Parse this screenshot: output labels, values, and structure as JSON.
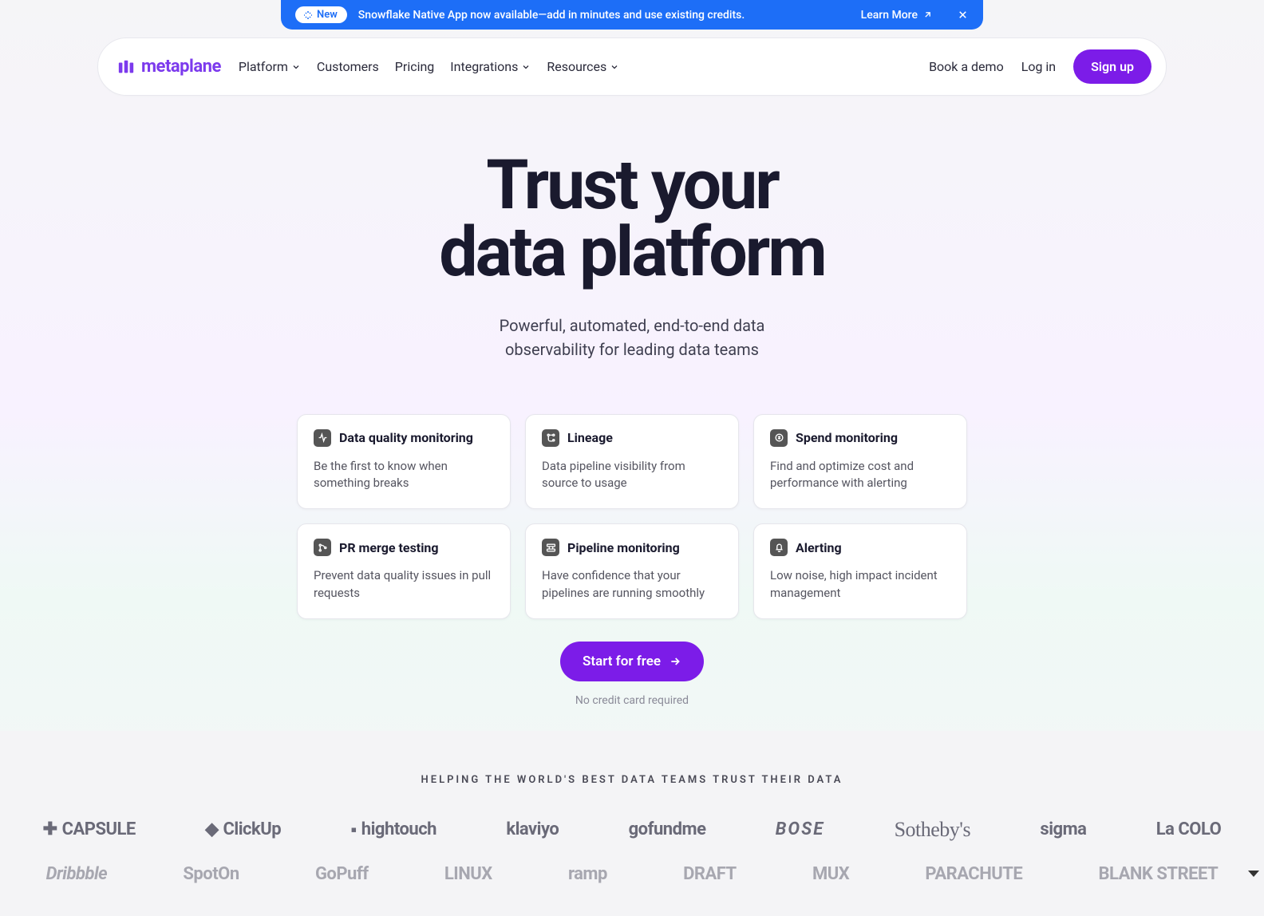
{
  "announcement": {
    "pill_label": "New",
    "text": "Snowflake Native App now available—add in minutes and use existing credits.",
    "learn_more": "Learn More"
  },
  "nav": {
    "brand": "metaplane",
    "items": [
      "Platform",
      "Customers",
      "Pricing",
      "Integrations",
      "Resources"
    ],
    "book_demo": "Book a demo",
    "log_in": "Log in",
    "sign_up": "Sign up"
  },
  "hero": {
    "title_line1": "Trust your",
    "title_line2": "data platform",
    "subtitle_line1": "Powerful, automated, end-to-end data",
    "subtitle_line2": "observability for leading data teams"
  },
  "cards": [
    {
      "title": "Data quality monitoring",
      "desc": "Be the first to know when something breaks"
    },
    {
      "title": "Lineage",
      "desc": "Data pipeline visibility from source to usage"
    },
    {
      "title": "Spend monitoring",
      "desc": "Find and optimize cost and performance with alerting"
    },
    {
      "title": "PR merge testing",
      "desc": "Prevent data quality issues in pull requests"
    },
    {
      "title": "Pipeline monitoring",
      "desc": "Have confidence that your pipelines are running smoothly"
    },
    {
      "title": "Alerting",
      "desc": "Low noise, high impact incident management"
    }
  ],
  "cta": {
    "button": "Start for free",
    "sub": "No credit card required"
  },
  "logos": {
    "heading": "HELPING THE WORLD'S BEST DATA TEAMS TRUST THEIR DATA",
    "row1": [
      "CAPSULE",
      "ClickUp",
      "hightouch",
      "klaviyo",
      "gofundme",
      "BOSE",
      "Sotheby's",
      "sigma",
      "La COLO"
    ],
    "row2": [
      "Dribbble",
      "SpotOn",
      "GoPuff",
      "LINUX",
      "ramp",
      "DRAFT",
      "MUX",
      "PARACHUTE",
      "BLANK STREET"
    ]
  }
}
